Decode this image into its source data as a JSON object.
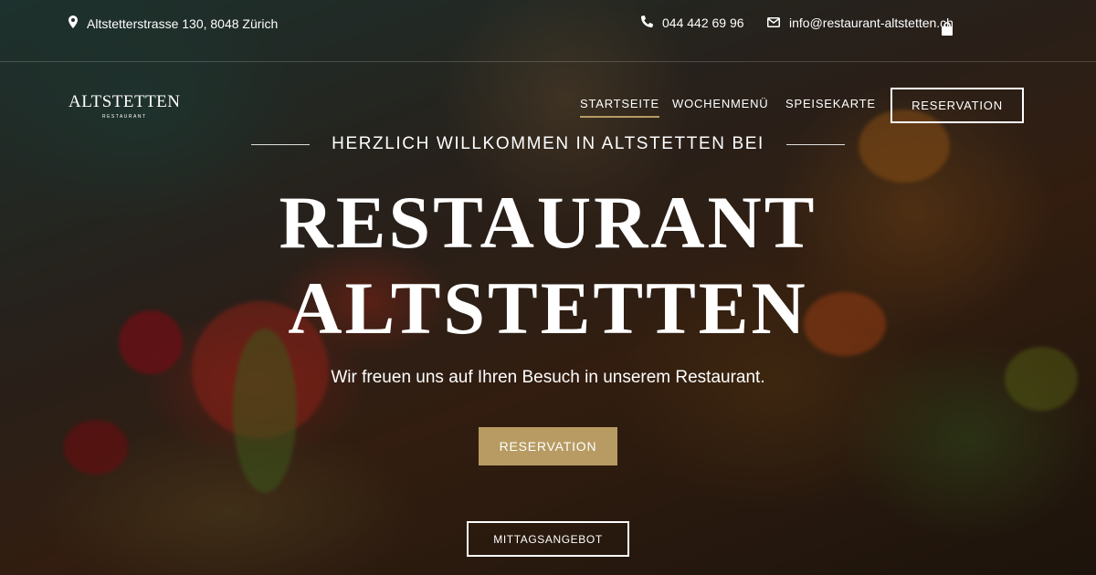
{
  "topbar": {
    "address": "Altstetterstrasse 130, 8048 Zürich",
    "phone": "044 442 69 96",
    "email": "info@restaurant-altstetten.ch",
    "address_icon": "map-pin-icon",
    "phone_icon": "phone-icon",
    "email_icon": "envelope-icon",
    "cart_icon": "shopping-bag-icon"
  },
  "logo": {
    "name": "ALTSTETTEN",
    "subtitle": "RESTAURANT"
  },
  "nav": {
    "items": [
      {
        "label": "STARTSEITE",
        "active": true
      },
      {
        "label": "WOCHENMENÜ",
        "active": false
      },
      {
        "label": "SPEISEKARTE",
        "active": false
      }
    ],
    "reservation_label": "RESERVATION"
  },
  "hero": {
    "welcome": "HERZLICH WILLKOMMEN IN ALTSTETTEN BEI",
    "title_line1": "RESTAURANT",
    "title_line2": "ALTSTETTEN",
    "tagline": "Wir freuen uns auf Ihren Besuch in unserem Restaurant.",
    "cta_label": "RESERVATION",
    "lunch_label": "MITTAGSANGEBOT"
  },
  "colors": {
    "accent_gold": "#b79b62",
    "text": "#ffffff"
  }
}
